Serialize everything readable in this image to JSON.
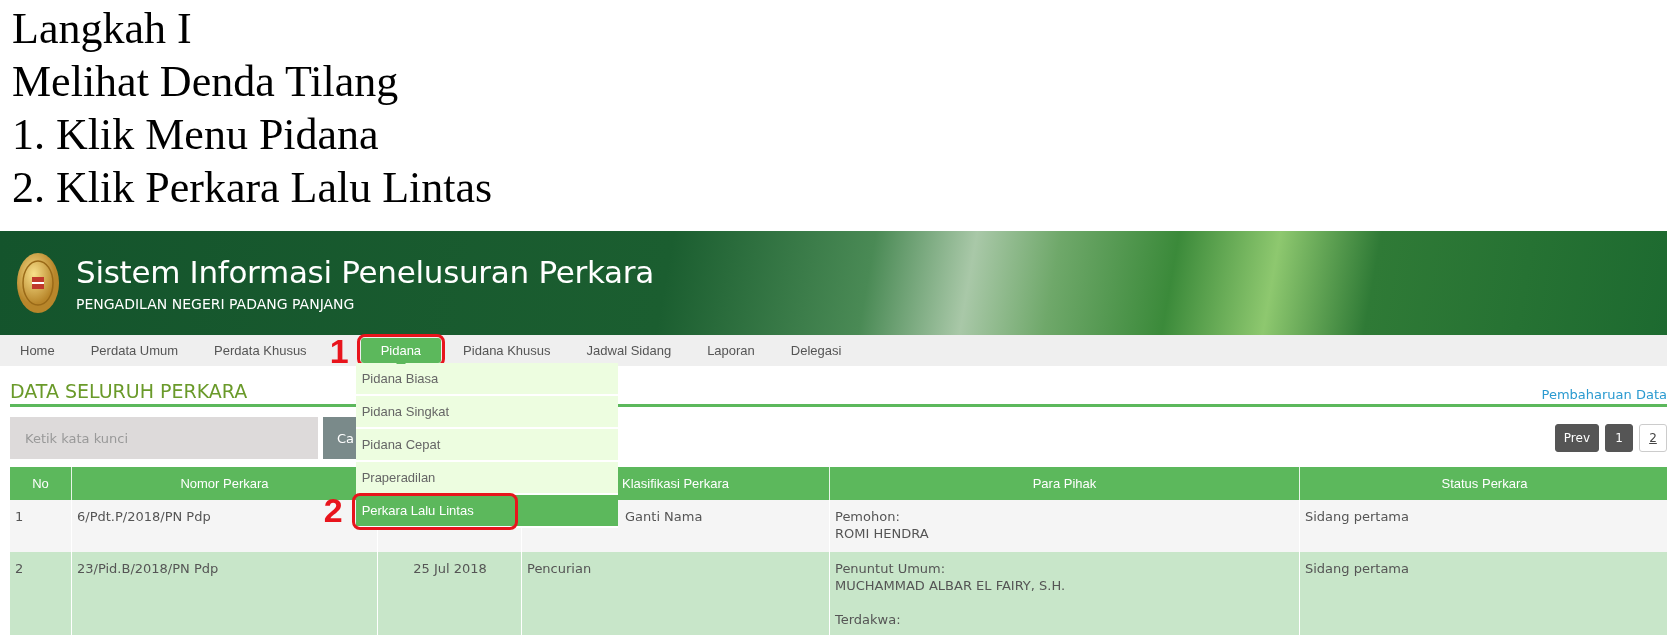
{
  "instructions": [
    "Langkah I",
    "Melihat Denda Tilang",
    "1. Klik Menu Pidana",
    "2. Klik Perkara Lalu Lintas"
  ],
  "header": {
    "title": "Sistem Informasi Penelusuran Perkara",
    "subtitle": "PENGADILAN NEGERI PADANG PANJANG"
  },
  "nav": [
    {
      "label": "Home",
      "selected": false
    },
    {
      "label": "Perdata Umum",
      "selected": false
    },
    {
      "label": "Perdata Khusus",
      "selected": false
    },
    {
      "label": "Pidana",
      "selected": true,
      "marker": "1",
      "menu": [
        {
          "label": "Pidana Biasa",
          "selected": false
        },
        {
          "label": "Pidana Singkat",
          "selected": false
        },
        {
          "label": "Pidana Cepat",
          "selected": false
        },
        {
          "label": "Praperadilan",
          "selected": false
        },
        {
          "label": "Perkara Lalu Lintas",
          "selected": true,
          "marker": "2"
        }
      ]
    },
    {
      "label": "Pidana Khusus",
      "selected": false
    },
    {
      "label": "Jadwal Sidang",
      "selected": false
    },
    {
      "label": "Laporan",
      "selected": false
    },
    {
      "label": "Delegasi",
      "selected": false
    }
  ],
  "page_title": "DATA SELURUH PERKARA",
  "update_link": "Pembaharuan Data",
  "search": {
    "placeholder": "Ketik kata kunci",
    "button": "Ca"
  },
  "pagination": [
    {
      "label": "Prev",
      "kind": "nav"
    },
    {
      "label": "1",
      "selected": true,
      "kind": "page"
    },
    {
      "label": "2",
      "selected": false,
      "kind": "page"
    }
  ],
  "table": {
    "columns": [
      "No",
      "Nomor Perkara",
      "",
      "Klasifikasi Perkara",
      "Para Pihak",
      "Status Perkara"
    ],
    "rows": [
      {
        "under_menu": true,
        "cells": [
          "1",
          "6/Pdt.P/2018/PN Pdp",
          "",
          "Ganti Nama",
          "Pemohon:\nROMI HENDRA",
          "Sidang pertama"
        ]
      },
      {
        "cells": [
          "2",
          "23/Pid.B/2018/PN Pdp",
          "25 Jul 2018",
          "Pencurian",
          "Penuntut Umum:\nMUCHAMMAD ALBAR EL FAIRY, S.H.\n\nTerdakwa:",
          "Sidang pertama"
        ]
      }
    ]
  }
}
